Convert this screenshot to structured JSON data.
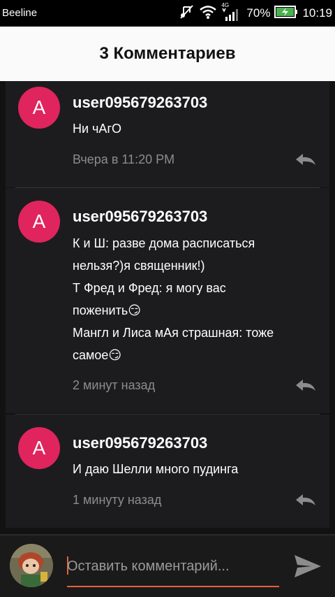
{
  "status_bar": {
    "carrier": "Beeline",
    "network_type": "4G",
    "battery_percent": "70%",
    "time": "10:19"
  },
  "header": {
    "title": "3 Комментариев"
  },
  "comments": [
    {
      "avatar_letter": "A",
      "username": "user095679263703",
      "text": "Ни чАгО",
      "time": "Вчера в 11:20 PM"
    },
    {
      "avatar_letter": "A",
      "username": "user095679263703",
      "text": "К и Ш: разве дома расписаться\nнельзя?)я священник!)\nТ Фред и Фред:  я могу вас\nпоженить😏\nМангл и Лиса мАя страшная: тоже\nсамое😏",
      "time": "2 минут назад"
    },
    {
      "avatar_letter": "A",
      "username": "user095679263703",
      "text": "И даю Шелли много пудинга",
      "time": "1 минуту назад"
    }
  ],
  "composer": {
    "placeholder": "Оставить комментарий..."
  },
  "colors": {
    "avatar": "#e0245e",
    "accent_underline": "#e8603c",
    "background": "#121212",
    "card": "#1c1c1e",
    "header": "#fafafa",
    "timestamp": "#8c8c8c"
  },
  "icons": [
    "mute-icon",
    "wifi-icon",
    "signal-icon",
    "battery-charging-icon",
    "reply-icon",
    "send-icon"
  ]
}
